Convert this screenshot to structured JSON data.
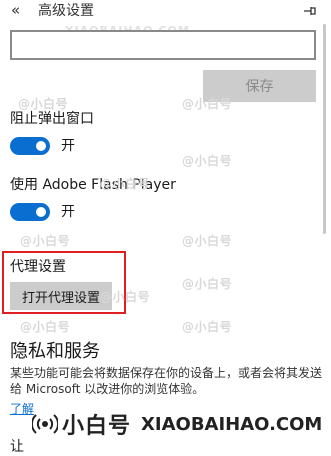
{
  "header": {
    "back_icon": "«",
    "title": "高级设置",
    "pin_icon": "pin-icon"
  },
  "watermark_top": "XIAOBAIHAO.COM",
  "watermark_repeat": [
    "@小白号",
    "@小白号",
    "@小白号",
    "@小白号",
    "@小白号",
    "@小白号",
    "@小白号",
    "@小白号",
    "@小白号",
    "@小白号"
  ],
  "save_label": "保存",
  "popup": {
    "label": "阻止弹出窗口",
    "state": "开"
  },
  "flash": {
    "label": "使用 Adobe Flash Player",
    "state": "开"
  },
  "proxy": {
    "label": "代理设置",
    "button": "打开代理设置"
  },
  "privacy": {
    "title": "隐私和服务",
    "desc": "某些功能可能会将数据保存在你的设备上，或者会将其发送给 Microsoft 以改进你的浏览体验。",
    "link": "了解",
    "cutoff": "让"
  },
  "footer": {
    "brand_cn": "小白号",
    "brand_url": "XIAOBAIHAO.COM"
  },
  "colors": {
    "accent": "#0a6ed1",
    "highlight_border": "#e02020",
    "button_bg": "#cccccc"
  }
}
